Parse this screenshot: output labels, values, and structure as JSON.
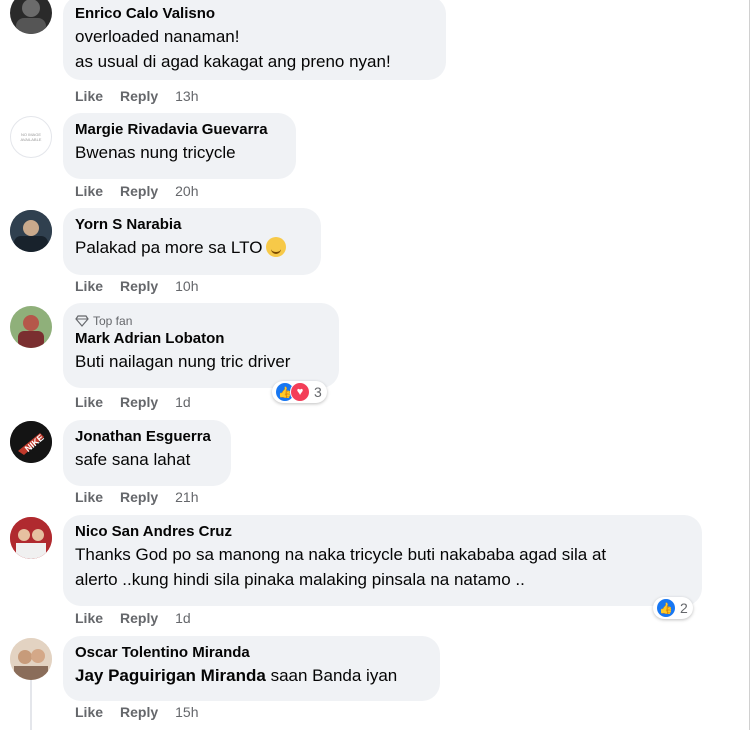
{
  "actions": {
    "like": "Like",
    "reply": "Reply"
  },
  "comments": [
    {
      "author": "Enrico Calo Valisno",
      "lines": [
        "overloaded nanaman!",
        "as usual di agad kakagat ang preno nyan!"
      ],
      "time": "13h"
    },
    {
      "author": "Margie Rivadavia Guevarra",
      "lines": [
        "Bwenas nung tricycle"
      ],
      "time": "20h",
      "avatar_text": "NO IMAGE AVAILABLE"
    },
    {
      "author": "Yorn S Narabia",
      "lines": [
        "Palakad pa more sa LTO"
      ],
      "time": "10h"
    },
    {
      "badge": "Top fan",
      "author": "Mark Adrian Lobaton",
      "lines": [
        "Buti nailagan nung tric driver"
      ],
      "time": "1d",
      "reactions": "3"
    },
    {
      "author": "Jonathan Esguerra",
      "lines": [
        "safe sana lahat"
      ],
      "time": "21h"
    },
    {
      "author": "Nico San Andres Cruz",
      "lines": [
        "Thanks God po sa manong na naka tricycle buti nakababa agad sila at",
        "alerto ..kung hindi sila pinaka malaking pinsala na natamo .."
      ],
      "time": "1d",
      "reactions": "2"
    },
    {
      "author": "Oscar Tolentino Miranda",
      "mention": "Jay Paguirigan Miranda",
      "lines": [
        "saan Banda iyan"
      ],
      "time": "15h"
    }
  ],
  "icons": {
    "top_fan": "diamond-icon",
    "reaction_like": "thumbs-up-icon",
    "reaction_love": "heart-icon",
    "emoji": "grinning-sweat-emoji"
  }
}
